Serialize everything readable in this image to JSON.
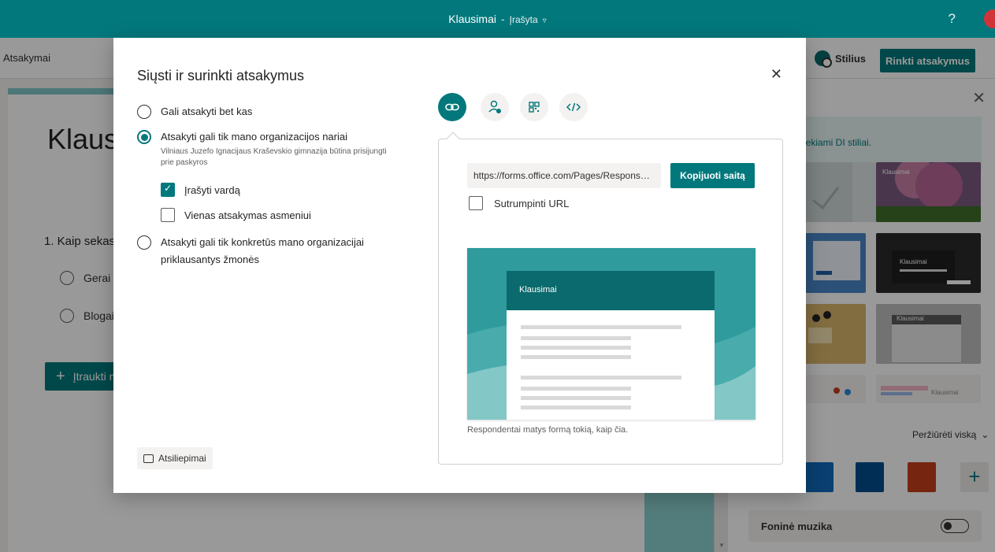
{
  "header": {
    "title": "Klausimai",
    "separator": "-",
    "status": "Įrašyta",
    "help": "?"
  },
  "commandbar": {
    "left_tab": "Atsakymai",
    "style_label": "Stilius",
    "collect_label": "Rinkti atsakymus"
  },
  "form": {
    "title_partial": "Klausi",
    "question_partial": "1. Kaip sekas",
    "options": [
      "Gerai",
      "Blogai"
    ],
    "insert_label_partial": "Įtraukti n"
  },
  "style_pane": {
    "ai_banner_partial": "iekiami DI stiliai.",
    "theme_label": "Klausimai",
    "view_all": "Peržiūrėti viską",
    "swatch_colors": [
      "#0f6cbd",
      "#004e8c",
      "#c43e1c"
    ],
    "music_label": "Foninė muzika"
  },
  "modal": {
    "title": "Siųsti ir surinkti atsakymus",
    "options": [
      {
        "label": "Gali atsakyti bet kas",
        "selected": false
      },
      {
        "label": "Atsakyti gali tik mano organizacijos nariai",
        "sub": "Vilniaus Juzefo Ignacijaus Kraševskio gimnazija būtina prisijungti prie paskyros",
        "selected": true
      },
      {
        "label": "Atsakyti gali tik konkretūs mano organizacijai priklausantys žmonės",
        "selected": false
      }
    ],
    "checks": [
      {
        "label": "Įrašyti vardą",
        "checked": true
      },
      {
        "label": "Vienas atsakymas asmeniui",
        "checked": false
      }
    ],
    "feedback": "Atsiliepimai",
    "share_icons": [
      "link-icon",
      "invite-people-icon",
      "qr-code-icon",
      "embed-code-icon"
    ],
    "url": "https://forms.office.com/Pages/ResponsePage.aspx",
    "copy_label": "Kopijuoti saitą",
    "shorten_label": "Sutrumpinti URL",
    "preview_title": "Klausimai",
    "preview_caption": "Respondentai matys formą tokią, kaip čia."
  },
  "colors": {
    "accent": "#03787c",
    "accent_dark": "#0b6a6d"
  }
}
